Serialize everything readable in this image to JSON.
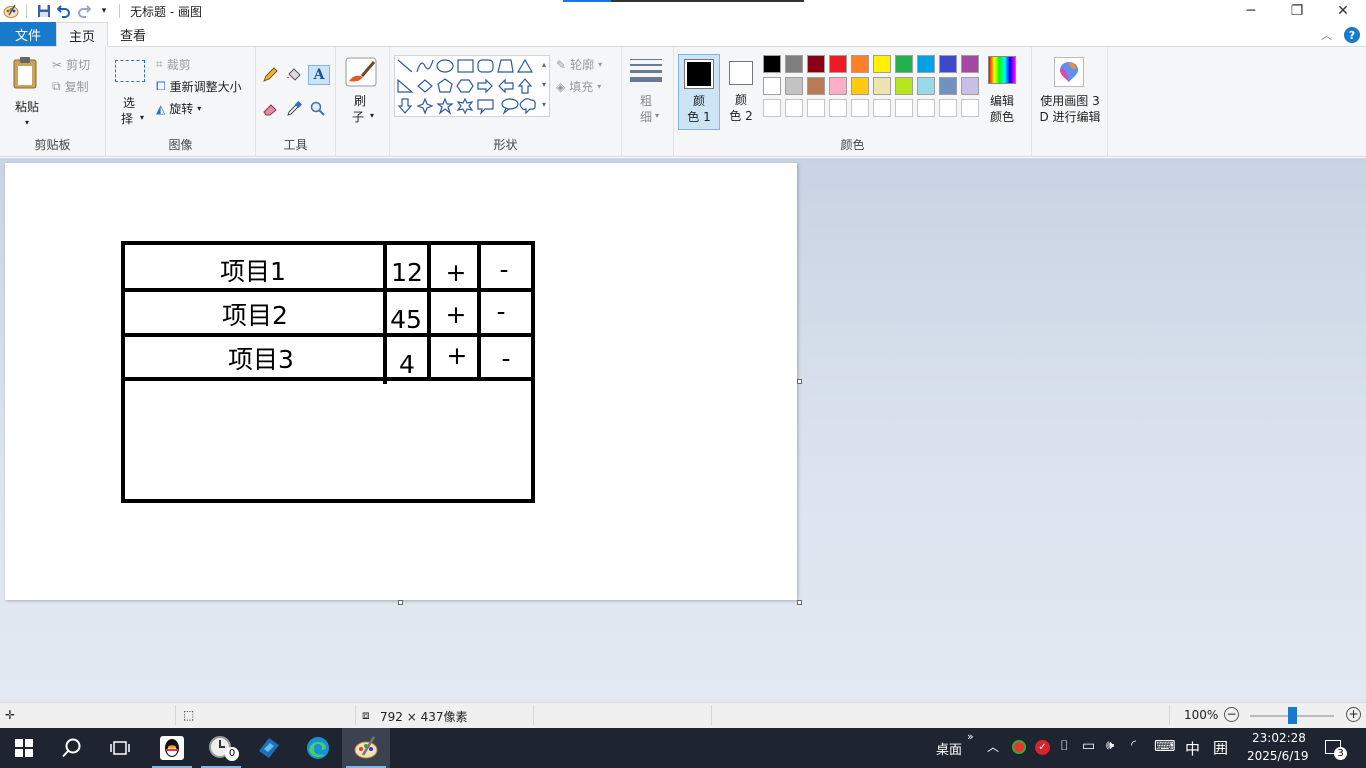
{
  "window": {
    "title": "无标题 - 画图"
  },
  "tabs": {
    "file": "文件",
    "home": "主页",
    "view": "查看"
  },
  "clipboard": {
    "paste": "粘贴",
    "cut": "剪切",
    "copy": "复制",
    "group": "剪贴板"
  },
  "image": {
    "select_top": "选",
    "select_bottom": "择",
    "crop": "裁剪",
    "resize": "重新调整大小",
    "rotate": "旋转",
    "group": "图像"
  },
  "tools": {
    "group": "工具"
  },
  "brush": {
    "top": "刷",
    "bottom": "子"
  },
  "shapes": {
    "outline": "轮廓",
    "fill": "填充",
    "group": "形状"
  },
  "size": {
    "top": "粗",
    "bottom": "细"
  },
  "colors": {
    "color1_top": "颜",
    "color1_bottom": "色 1",
    "color2_top": "颜",
    "color2_bottom": "色 2",
    "edit_top": "编辑",
    "edit_bottom": "颜色",
    "group": "颜色",
    "color1_value": "#000000",
    "color2_value": "#ffffff",
    "palette_row1": [
      "#000000",
      "#7f7f7f",
      "#880015",
      "#ed1c24",
      "#ff7f27",
      "#fff200",
      "#22b14c",
      "#00a2e8",
      "#3f48cc",
      "#a349a4"
    ],
    "palette_row2": [
      "#ffffff",
      "#c3c3c3",
      "#b97a57",
      "#ffaec9",
      "#ffc90e",
      "#efe4b0",
      "#b5e61d",
      "#99d9ea",
      "#7092be",
      "#c8bfe7"
    ],
    "palette_row3": [
      "#ffffff",
      "#ffffff",
      "#ffffff",
      "#ffffff",
      "#ffffff",
      "#ffffff",
      "#ffffff",
      "#ffffff",
      "#ffffff",
      "#ffffff"
    ]
  },
  "paint3d": {
    "line1": "使用画图 3",
    "line2": "D 进行编辑"
  },
  "drawing": {
    "items": [
      {
        "name": "项目1",
        "count": "12",
        "plus": "+",
        "minus": "-"
      },
      {
        "name": "项目2",
        "count": "45",
        "plus": "+",
        "minus": "-"
      },
      {
        "name": "项目3",
        "count": "4",
        "plus": "+",
        "minus": "-"
      }
    ]
  },
  "status": {
    "dimensions": "792 × 437像素",
    "zoom": "100%",
    "zoom_level": 1.0
  },
  "taskbar": {
    "desktop": "桌面",
    "ime": "中",
    "time": "23:02:28",
    "date": "2025/6/19",
    "notifications": "3",
    "badge": "0"
  }
}
